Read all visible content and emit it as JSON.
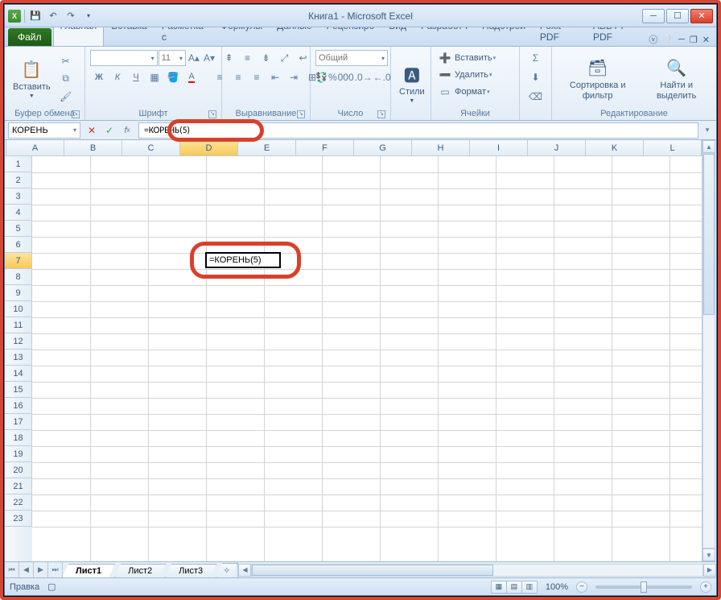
{
  "window": {
    "title": "Книга1 - Microsoft Excel"
  },
  "tabs": {
    "file": "Файл",
    "items": [
      "Главная",
      "Вставка",
      "Разметка с",
      "Формулы",
      "Данные",
      "Рецензиро",
      "Вид",
      "Разработч",
      "Надстрой",
      "Foxit PDF",
      "ABBYY PDF"
    ],
    "active": 0
  },
  "ribbon": {
    "clipboard": {
      "label": "Буфер обмена",
      "paste": "Вставить"
    },
    "font": {
      "label": "Шрифт",
      "name": "",
      "size": "11"
    },
    "alignment": {
      "label": "Выравнивание"
    },
    "number": {
      "label": "Число",
      "format": "Общий"
    },
    "styles": {
      "label": "",
      "btn": "Стили"
    },
    "cells": {
      "label": "Ячейки",
      "insert": "Вставить",
      "delete": "Удалить",
      "format": "Формат"
    },
    "editing": {
      "label": "Редактирование",
      "sort": "Сортировка и фильтр",
      "find": "Найти и выделить"
    }
  },
  "formula_bar": {
    "name_box": "КОРЕНЬ",
    "formula": "=КОРЕНЬ(5)"
  },
  "grid": {
    "columns": [
      "A",
      "B",
      "C",
      "D",
      "E",
      "F",
      "G",
      "H",
      "I",
      "J",
      "K",
      "L"
    ],
    "row_count": 23,
    "active": {
      "col": 3,
      "row": 7,
      "display": "=КОРЕНЬ(5)"
    },
    "selected_col": 3,
    "selected_row": 7
  },
  "sheets": {
    "items": [
      "Лист1",
      "Лист2",
      "Лист3"
    ],
    "active": 0
  },
  "status": {
    "mode": "Правка",
    "zoom": "100%"
  }
}
